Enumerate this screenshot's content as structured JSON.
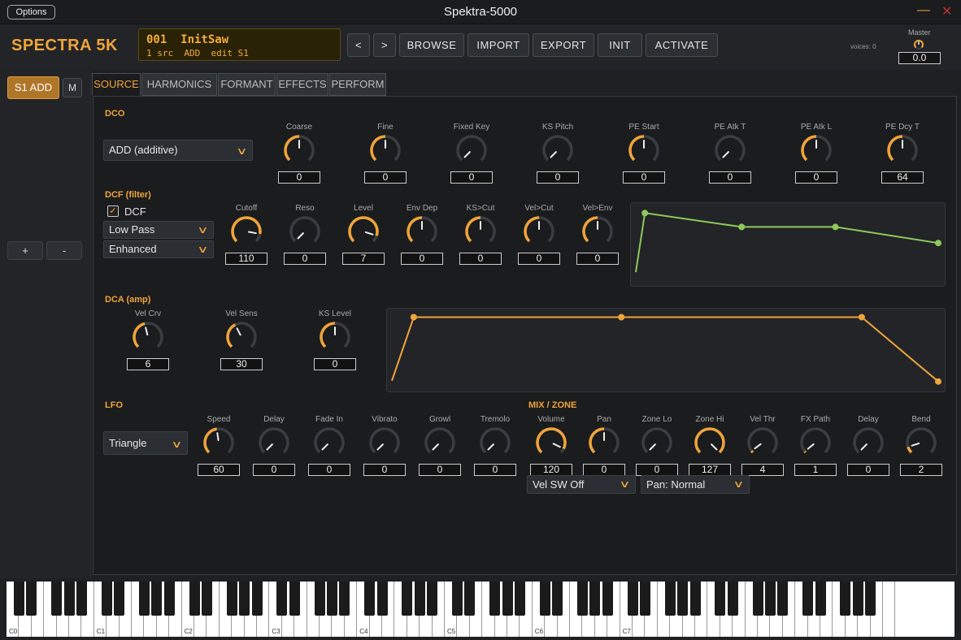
{
  "window": {
    "options_label": "Options",
    "title": "Spektra-5000",
    "minimize_glyph": "—",
    "close_glyph": "✕"
  },
  "header": {
    "logo": "SPECTRA 5K",
    "lcd_line1": "001  InitSaw",
    "lcd_line2": "1 src  ADD  edit S1",
    "prev_label": "<",
    "next_label": ">",
    "browse_label": "BROWSE",
    "import_label": "IMPORT",
    "export_label": "EXPORT",
    "init_label": "INIT",
    "activate_label": "ACTIVATE",
    "voices": "voices: 0",
    "master_label": "Master",
    "master_value": "0.0"
  },
  "left": {
    "s1_label": "S1 ADD",
    "m_label": "M",
    "plus_label": "+",
    "minus_label": "-"
  },
  "tabs": [
    "SOURCE",
    "HARMONICS",
    "FORMANT",
    "EFFECTS",
    "PERFORM"
  ],
  "dco": {
    "title": "DCO",
    "mode": "ADD (additive)",
    "knobs": [
      {
        "label": "Coarse",
        "value": "0",
        "level": 0.5
      },
      {
        "label": "Fine",
        "value": "0",
        "level": 0.5
      },
      {
        "label": "Fixed Key",
        "value": "0",
        "level": 0.0
      },
      {
        "label": "KS Pitch",
        "value": "0",
        "level": 0.0
      },
      {
        "label": "PE Start",
        "value": "0",
        "level": 0.5
      },
      {
        "label": "PE Atk T",
        "value": "0",
        "level": 0.0
      },
      {
        "label": "PE Atk L",
        "value": "0",
        "level": 0.5
      },
      {
        "label": "PE Dcy T",
        "value": "64",
        "level": 0.5
      }
    ]
  },
  "dcf": {
    "title": "DCF (filter)",
    "enable_label": "DCF",
    "enabled_glyph": "✓",
    "type": "Low Pass",
    "quality": "Enhanced",
    "knobs": [
      {
        "label": "Cutoff",
        "value": "110",
        "level": 0.87
      },
      {
        "label": "Reso",
        "value": "0",
        "level": 0.0
      },
      {
        "label": "Level",
        "value": "7",
        "level": 0.9
      },
      {
        "label": "Env Dep",
        "value": "0",
        "level": 0.5
      },
      {
        "label": "KS>Cut",
        "value": "0",
        "level": 0.5
      },
      {
        "label": "Vel>Cut",
        "value": "0",
        "level": 0.5
      },
      {
        "label": "Vel>Env",
        "value": "0",
        "level": 0.5
      }
    ],
    "envelope": [
      [
        0,
        0.12
      ],
      [
        0.03,
        0.93
      ],
      [
        0.35,
        0.74
      ],
      [
        0.66,
        0.74
      ],
      [
        1,
        0.52
      ]
    ]
  },
  "dca": {
    "title": "DCA (amp)",
    "knobs": [
      {
        "label": "Vel Crv",
        "value": "6",
        "level": 0.45
      },
      {
        "label": "Vel Sens",
        "value": "30",
        "level": 0.4
      },
      {
        "label": "KS Level",
        "value": "0",
        "level": 0.5
      }
    ],
    "envelope": [
      [
        0,
        0.08
      ],
      [
        0.04,
        0.95
      ],
      [
        0.42,
        0.95
      ],
      [
        0.86,
        0.95
      ],
      [
        1,
        0.07
      ]
    ]
  },
  "lfo": {
    "title": "LFO",
    "wave": "Triangle",
    "knobs": [
      {
        "label": "Speed",
        "value": "60",
        "level": 0.47
      },
      {
        "label": "Delay",
        "value": "0",
        "level": 0.0
      },
      {
        "label": "Fade In",
        "value": "0",
        "level": 0.0
      },
      {
        "label": "Vibrato",
        "value": "0",
        "level": 0.0
      },
      {
        "label": "Growl",
        "value": "0",
        "level": 0.0
      },
      {
        "label": "Tremolo",
        "value": "0",
        "level": 0.0
      }
    ]
  },
  "mix": {
    "title": "MIX / ZONE",
    "vel_sw": "Vel SW Off",
    "pan_mode": "Pan: Normal",
    "knobs": [
      {
        "label": "Volume",
        "value": "120",
        "level": 0.93
      },
      {
        "label": "Pan",
        "value": "0",
        "level": 0.5
      },
      {
        "label": "Zone Lo",
        "value": "0",
        "level": 0.0
      },
      {
        "label": "Zone Hi",
        "value": "127",
        "level": 1.0
      },
      {
        "label": "Vel Thr",
        "value": "4",
        "level": 0.03
      },
      {
        "label": "FX Path",
        "value": "1",
        "level": 0.02
      },
      {
        "label": "Delay",
        "value": "0",
        "level": 0.0
      },
      {
        "label": "Bend",
        "value": "2",
        "level": 0.1
      }
    ]
  },
  "keyboard": {
    "octave_labels": [
      "C0",
      "C1",
      "C2",
      "C3",
      "C4",
      "C5",
      "C6",
      "C7"
    ]
  },
  "colors": {
    "accent": "#f0a43a",
    "dcf_env": "#8dc85a",
    "dca_env": "#f0a43a",
    "track": "#3a3d41"
  }
}
